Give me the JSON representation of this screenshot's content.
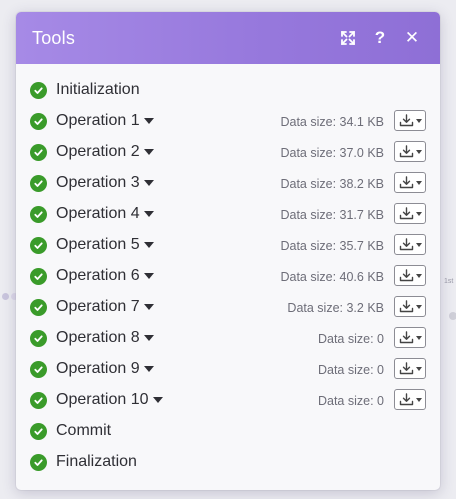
{
  "panel": {
    "title": "Tools",
    "colors": {
      "header_start": "#a68ae6",
      "header_end": "#8e6fd6",
      "success": "#3a9b2a"
    },
    "header_buttons": [
      {
        "icon": "expand-icon"
      },
      {
        "icon": "help-icon",
        "glyph": "?"
      },
      {
        "icon": "close-icon",
        "glyph": "✕"
      }
    ]
  },
  "background": {
    "right_label": "1st"
  },
  "steps": [
    {
      "label": "Initialization"
    },
    {
      "label": "Operation 1",
      "size": "Data size: 34.1 KB"
    },
    {
      "label": "Operation 2",
      "size": "Data size: 37.0 KB"
    },
    {
      "label": "Operation 3",
      "size": "Data size: 38.2 KB"
    },
    {
      "label": "Operation 4",
      "size": "Data size: 31.7 KB"
    },
    {
      "label": "Operation 5",
      "size": "Data size: 35.7 KB"
    },
    {
      "label": "Operation 6",
      "size": "Data size: 40.6 KB"
    },
    {
      "label": "Operation 7",
      "size": "Data size: 3.2 KB"
    },
    {
      "label": "Operation 8",
      "size": "Data size: 0"
    },
    {
      "label": "Operation 9",
      "size": "Data size: 0"
    },
    {
      "label": "Operation 10",
      "size": "Data size: 0"
    },
    {
      "label": "Commit"
    },
    {
      "label": "Finalization"
    }
  ]
}
